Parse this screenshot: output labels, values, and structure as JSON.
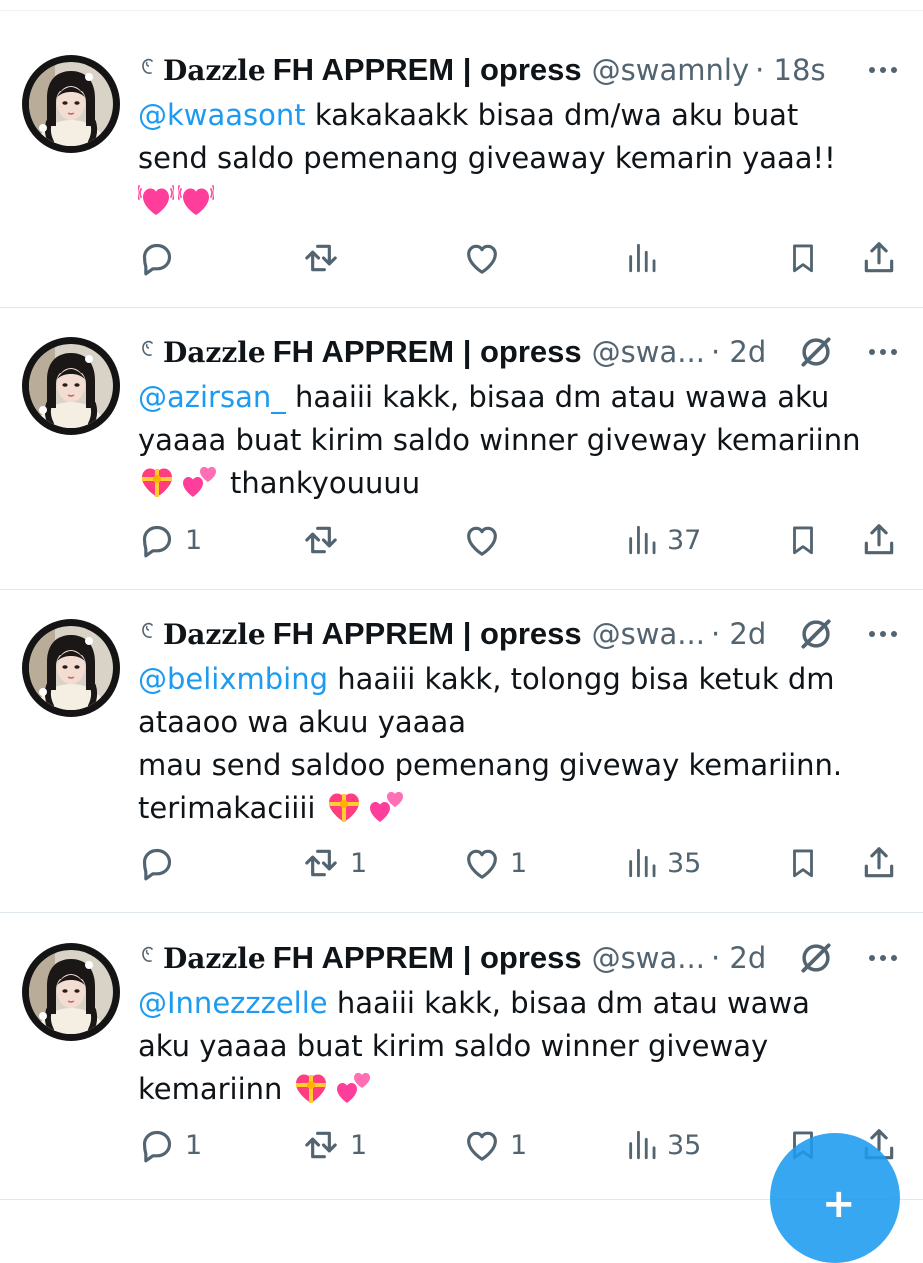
{
  "icons": {
    "author": "verified-grey-icon",
    "grok": "grok-icon",
    "more": "more-icon",
    "reply": "reply-icon",
    "retweet": "retweet-icon",
    "like": "like-icon",
    "views": "views-icon",
    "bookmark": "bookmark-icon",
    "share": "share-icon"
  },
  "colors": {
    "mention": "#1d9bf0",
    "secondary": "#536471",
    "fab": "#1d9bf0"
  },
  "tweets": [
    {
      "name_serif": "Dazzle",
      "name_sans": "FH APPREM | opress",
      "handle": "@swamnly",
      "time": "· 18s",
      "mention": "@kwaasont",
      "text": " kakakaakk bisaa dm/wa aku buat\nsend saldo pemenang giveaway kemarin yaaa!!",
      "emojis": [
        "growing-heart",
        "growing-heart"
      ],
      "tail": "",
      "reply_count": "",
      "retweet_count": "",
      "like_count": "",
      "view_count": ""
    },
    {
      "name_serif": "Dazzle",
      "name_sans": "FH APPREM | opress",
      "handle": "@swa...",
      "time": "· 2d",
      "mention": "@azirsan_",
      "text": " haaiii kakk, bisaa dm atau wawa aku\nyaaaa buat kirim saldo winner giveway kemariinn",
      "emojis": [
        "heart-ribbon",
        "two-hearts"
      ],
      "tail": "thankyouuuu",
      "reply_count": "1",
      "retweet_count": "",
      "like_count": "",
      "view_count": "37"
    },
    {
      "name_serif": "Dazzle",
      "name_sans": "FH APPREM | opress",
      "handle": "@swa...",
      "time": "· 2d",
      "mention": "@belixmbing",
      "text": " haaiii kakk, tolongg bisa ketuk dm\nataaoo wa akuu yaaaa\nmau send saldoo pemenang giveway kemariinn.\nterimakaciiii",
      "emojis": [
        "heart-ribbon",
        "two-hearts"
      ],
      "tail": "",
      "reply_count": "",
      "retweet_count": "1",
      "like_count": "1",
      "view_count": "35"
    },
    {
      "name_serif": "Dazzle",
      "name_sans": "FH APPREM | opress",
      "handle": "@swa...",
      "time": "· 2d",
      "mention": "@Innezzzelle",
      "text": " haaiii kakk, bisaa dm atau wawa\naku yaaaa buat kirim saldo winner giveway\nkemariinn",
      "emojis": [
        "heart-ribbon",
        "two-hearts"
      ],
      "tail": "",
      "reply_count": "1",
      "retweet_count": "1",
      "like_count": "1",
      "view_count": "35"
    }
  ]
}
